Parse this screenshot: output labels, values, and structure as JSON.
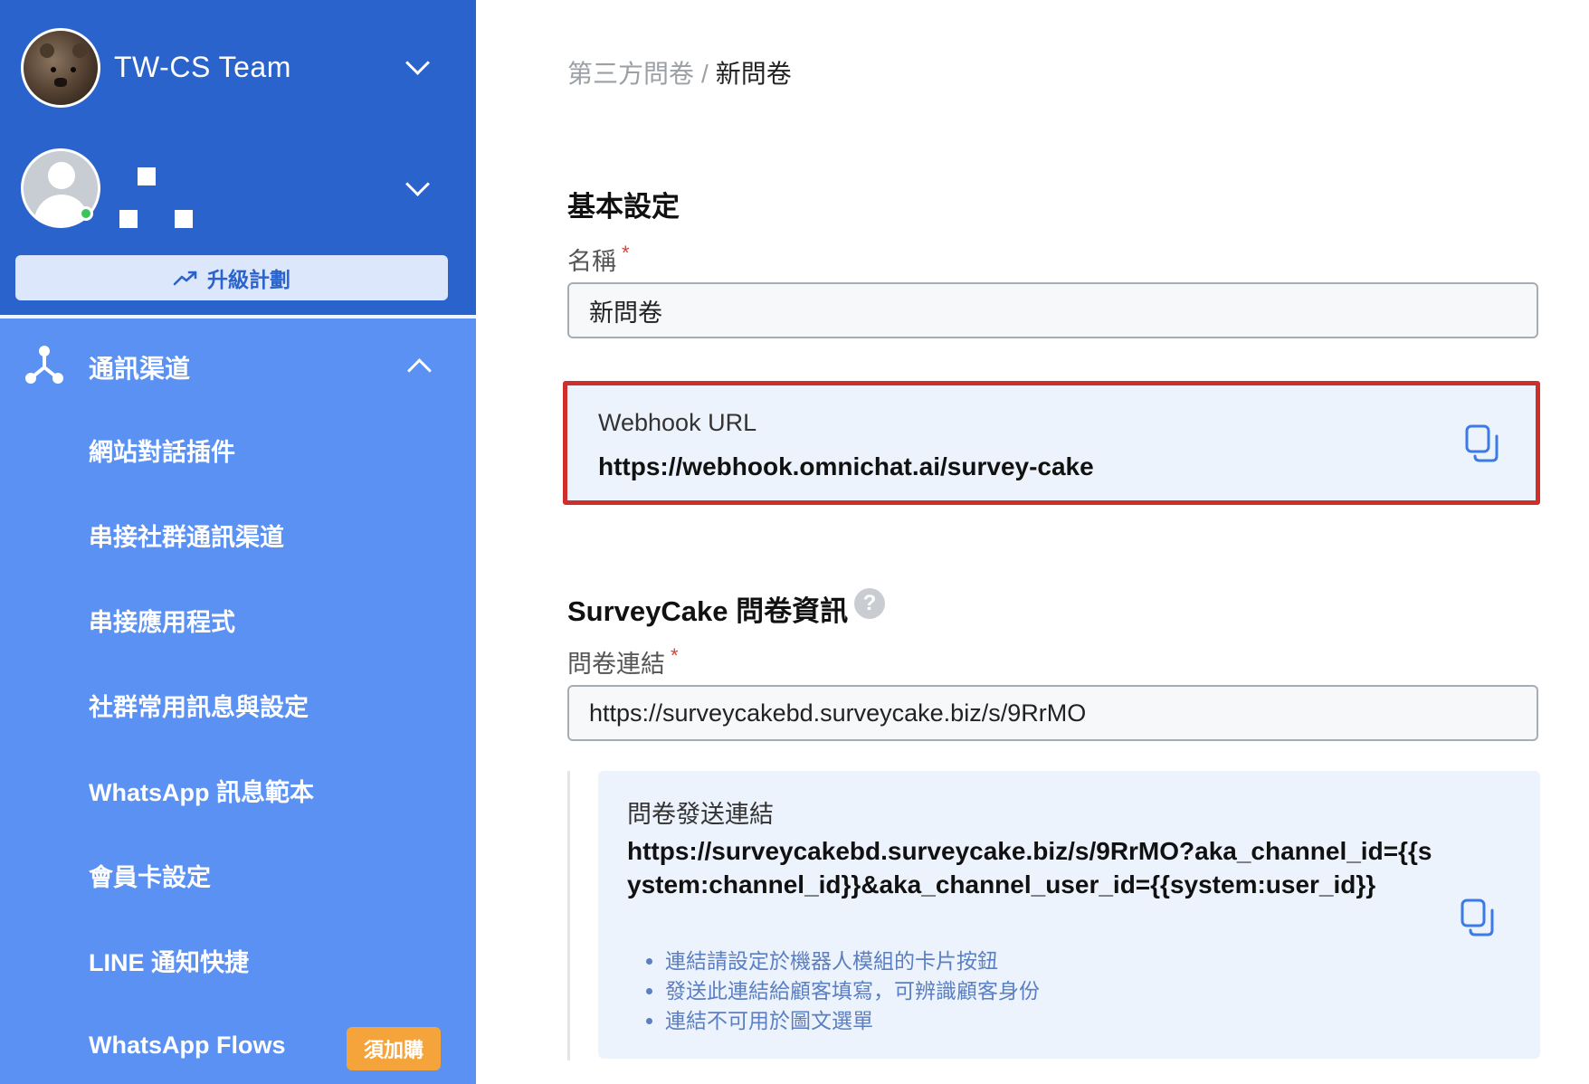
{
  "colors": {
    "sidebar_top": "#2b63cc",
    "sidebar_bg": "#5a91f2",
    "badge": "#f4a43a",
    "highlight_border": "#cf2f2a",
    "accent": "#2b63cc"
  },
  "sidebar": {
    "team_name": "TW-CS Team",
    "upgrade_label": "升級計劃",
    "section_label": "通訊渠道",
    "items": [
      {
        "label": "網站對話插件"
      },
      {
        "label": "串接社群通訊渠道"
      },
      {
        "label": "串接應用程式"
      },
      {
        "label": "社群常用訊息與設定"
      },
      {
        "label": "WhatsApp 訊息範本"
      },
      {
        "label": "會員卡設定"
      },
      {
        "label": "LINE 通知快捷"
      },
      {
        "label": "WhatsApp Flows",
        "badge": "須加購"
      }
    ]
  },
  "breadcrumb": {
    "parent": "第三方問卷",
    "separator": "/",
    "current": "新問卷"
  },
  "basic": {
    "title": "基本設定",
    "name_label": "名稱",
    "required_mark": "*",
    "name_value": "新問卷"
  },
  "webhook": {
    "label": "Webhook URL",
    "value": "https://webhook.omnichat.ai/survey-cake"
  },
  "surveycake": {
    "title": "SurveyCake 問卷資訊",
    "help": "?",
    "link_label": "問卷連結",
    "link_value": "https://surveycakebd.surveycake.biz/s/9RrMO",
    "send_label": "問卷發送連結",
    "send_value": "https://surveycakebd.surveycake.biz/s/9RrMO?aka_channel_id={{system:channel_id}}&aka_channel_user_id={{system:user_id}}",
    "notes": [
      "連結請設定於機器人模組的卡片按鈕",
      "發送此連結給顧客填寫，可辨識顧客身份",
      "連結不可用於圖文選單"
    ]
  },
  "icons": [
    "chevron-down-icon",
    "user-icon",
    "trend-up-icon",
    "hub-icon",
    "chevron-up-icon",
    "copy-icon",
    "help-icon"
  ]
}
